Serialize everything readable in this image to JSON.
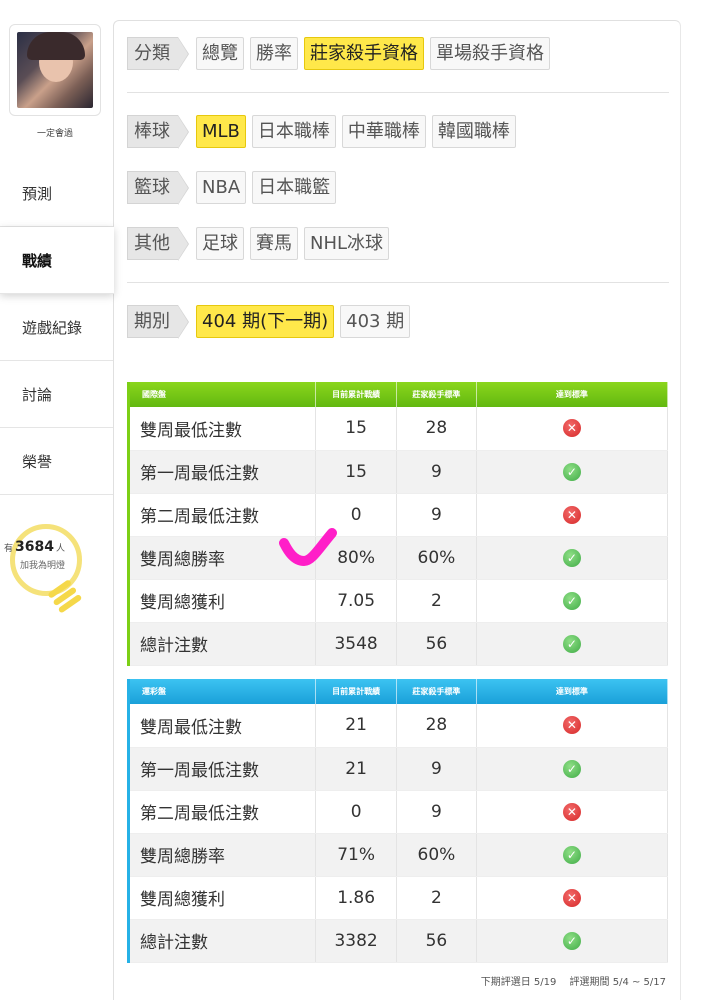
{
  "sidebar": {
    "user_name": "一定會過",
    "nav": [
      {
        "label": "預測"
      },
      {
        "label": "戰績"
      },
      {
        "label": "遊戲紀錄"
      },
      {
        "label": "討論"
      },
      {
        "label": "榮譽"
      }
    ],
    "fans": {
      "prefix": "有",
      "count": "3684",
      "suffix": "人",
      "sub": "加我為明燈"
    }
  },
  "filters": {
    "category": {
      "label": "分類",
      "options": [
        "總覽",
        "勝率",
        "莊家殺手資格",
        "單場殺手資格"
      ],
      "selected": "莊家殺手資格"
    },
    "baseball": {
      "label": "棒球",
      "options": [
        "MLB",
        "日本職棒",
        "中華職棒",
        "韓國職棒"
      ],
      "selected": "MLB"
    },
    "basketball": {
      "label": "籃球",
      "options": [
        "NBA",
        "日本職籃"
      ]
    },
    "other": {
      "label": "其他",
      "options": [
        "足球",
        "賽馬",
        "NHL冰球"
      ]
    },
    "period": {
      "label": "期別",
      "options": [
        "404 期(下一期)",
        "403 期"
      ],
      "selected": "404 期(下一期)"
    }
  },
  "tables": [
    {
      "headers": [
        "國際盤",
        "目前累計戰績",
        "莊家殺手標準",
        "達到標準"
      ],
      "accent": "#7ccf16",
      "rows": [
        {
          "name": "雙周最低注數",
          "current": "15",
          "standard": "28",
          "met": false
        },
        {
          "name": "第一周最低注數",
          "current": "15",
          "standard": "9",
          "met": true
        },
        {
          "name": "第二周最低注數",
          "current": "0",
          "standard": "9",
          "met": false
        },
        {
          "name": "雙周總勝率",
          "current": "80%",
          "standard": "60%",
          "met": true
        },
        {
          "name": "雙周總獲利",
          "current": "7.05",
          "standard": "2",
          "met": true
        },
        {
          "name": "總計注數",
          "current": "3548",
          "standard": "56",
          "met": true
        }
      ]
    },
    {
      "headers": [
        "運彩盤",
        "目前累計戰績",
        "莊家殺手標準",
        "達到標準"
      ],
      "accent": "#26b1e6",
      "rows": [
        {
          "name": "雙周最低注數",
          "current": "21",
          "standard": "28",
          "met": false
        },
        {
          "name": "第一周最低注數",
          "current": "21",
          "standard": "9",
          "met": true
        },
        {
          "name": "第二周最低注數",
          "current": "0",
          "standard": "9",
          "met": false
        },
        {
          "name": "雙周總勝率",
          "current": "71%",
          "standard": "60%",
          "met": true
        },
        {
          "name": "雙周總獲利",
          "current": "1.86",
          "standard": "2",
          "met": false
        },
        {
          "name": "總計注數",
          "current": "3382",
          "standard": "56",
          "met": true
        }
      ]
    }
  ],
  "footer": {
    "next_review": "下期評選日 5/19",
    "review_period": "評選期間 5/4 ~ 5/17"
  },
  "colors": {
    "selected": "#ffe84a",
    "pass": "#3fab46",
    "fail": "#d62828",
    "annotation": "#ff1fc8"
  }
}
